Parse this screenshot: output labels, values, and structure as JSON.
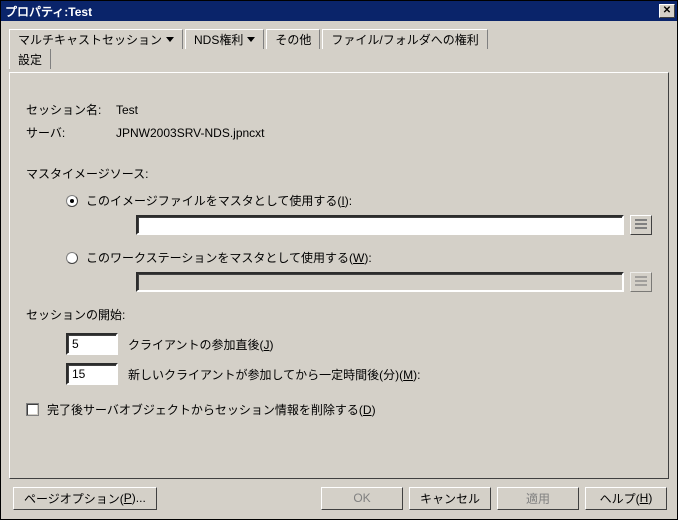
{
  "window": {
    "title": "プロパティ:Test"
  },
  "tabs": {
    "multicast": "マルチキャストセッション",
    "settings": "設定",
    "nds": "NDS権利",
    "other": "その他",
    "filefolder": "ファイル/フォルダへの権利"
  },
  "fields": {
    "session_name_label": "セッション名:",
    "session_name_value": "Test",
    "server_label": "サーバ:",
    "server_value": "JPNW2003SRV-NDS.jpncxt"
  },
  "master_image": {
    "title": "マスタイメージソース:",
    "radio_image_prefix": "このイメージファイルをマスタとして使用する(",
    "radio_image_key": "I",
    "radio_image_suffix": "):",
    "image_path": "",
    "radio_ws_prefix": "このワークステーションをマスタとして使用する(",
    "radio_ws_key": "W",
    "radio_ws_suffix": "):",
    "ws_path": ""
  },
  "session_start": {
    "title": "セッションの開始:",
    "clients_value": "5",
    "clients_label_prefix": "クライアントの参加直後(",
    "clients_key": "J",
    "clients_label_suffix": ")",
    "minutes_value": "15",
    "minutes_label_prefix": "新しいクライアントが参加してから一定時間後(分)(",
    "minutes_key": "M",
    "minutes_label_suffix": "):"
  },
  "delete_check": {
    "prefix": "完了後サーバオブジェクトからセッション情報を削除する(",
    "key": "D",
    "suffix": ")"
  },
  "buttons": {
    "page_options_prefix": "ページオプション(",
    "page_options_key": "P",
    "page_options_suffix": ")...",
    "ok": "OK",
    "cancel": "キャンセル",
    "apply": "適用",
    "help_prefix": "ヘルプ(",
    "help_key": "H",
    "help_suffix": ")"
  }
}
